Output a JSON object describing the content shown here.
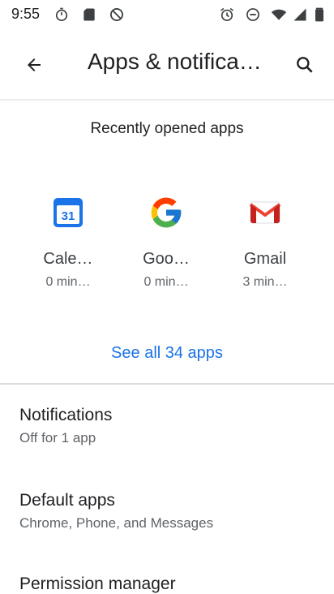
{
  "status_bar": {
    "time": "9:55",
    "left_icons": [
      "stopwatch-icon",
      "sd-card-icon",
      "do-not-disturb-off-icon"
    ],
    "right_icons": [
      "alarm-icon",
      "minus-circle-icon",
      "wifi-icon",
      "cellular-signal-icon",
      "battery-icon"
    ]
  },
  "app_bar": {
    "title": "Apps & notifications",
    "back_icon": "arrow-back-icon",
    "search_icon": "search-icon"
  },
  "recent": {
    "title": "Recently opened apps",
    "apps": [
      {
        "name": "Cale…",
        "time": "0 min…",
        "icon": "calendar-icon",
        "icon_text": "31"
      },
      {
        "name": "Goo…",
        "time": "0 min…",
        "icon": "google-icon"
      },
      {
        "name": "Gmail",
        "time": "3 min…",
        "icon": "gmail-icon"
      }
    ],
    "see_all": "See all 34 apps"
  },
  "settings": [
    {
      "title": "Notifications",
      "subtitle": "Off for 1 app"
    },
    {
      "title": "Default apps",
      "subtitle": "Chrome, Phone, and Messages"
    },
    {
      "title": "Permission manager",
      "subtitle": ""
    }
  ],
  "colors": {
    "accent": "#1a73e8",
    "text_primary": "#202124",
    "text_secondary": "#5f6368"
  }
}
